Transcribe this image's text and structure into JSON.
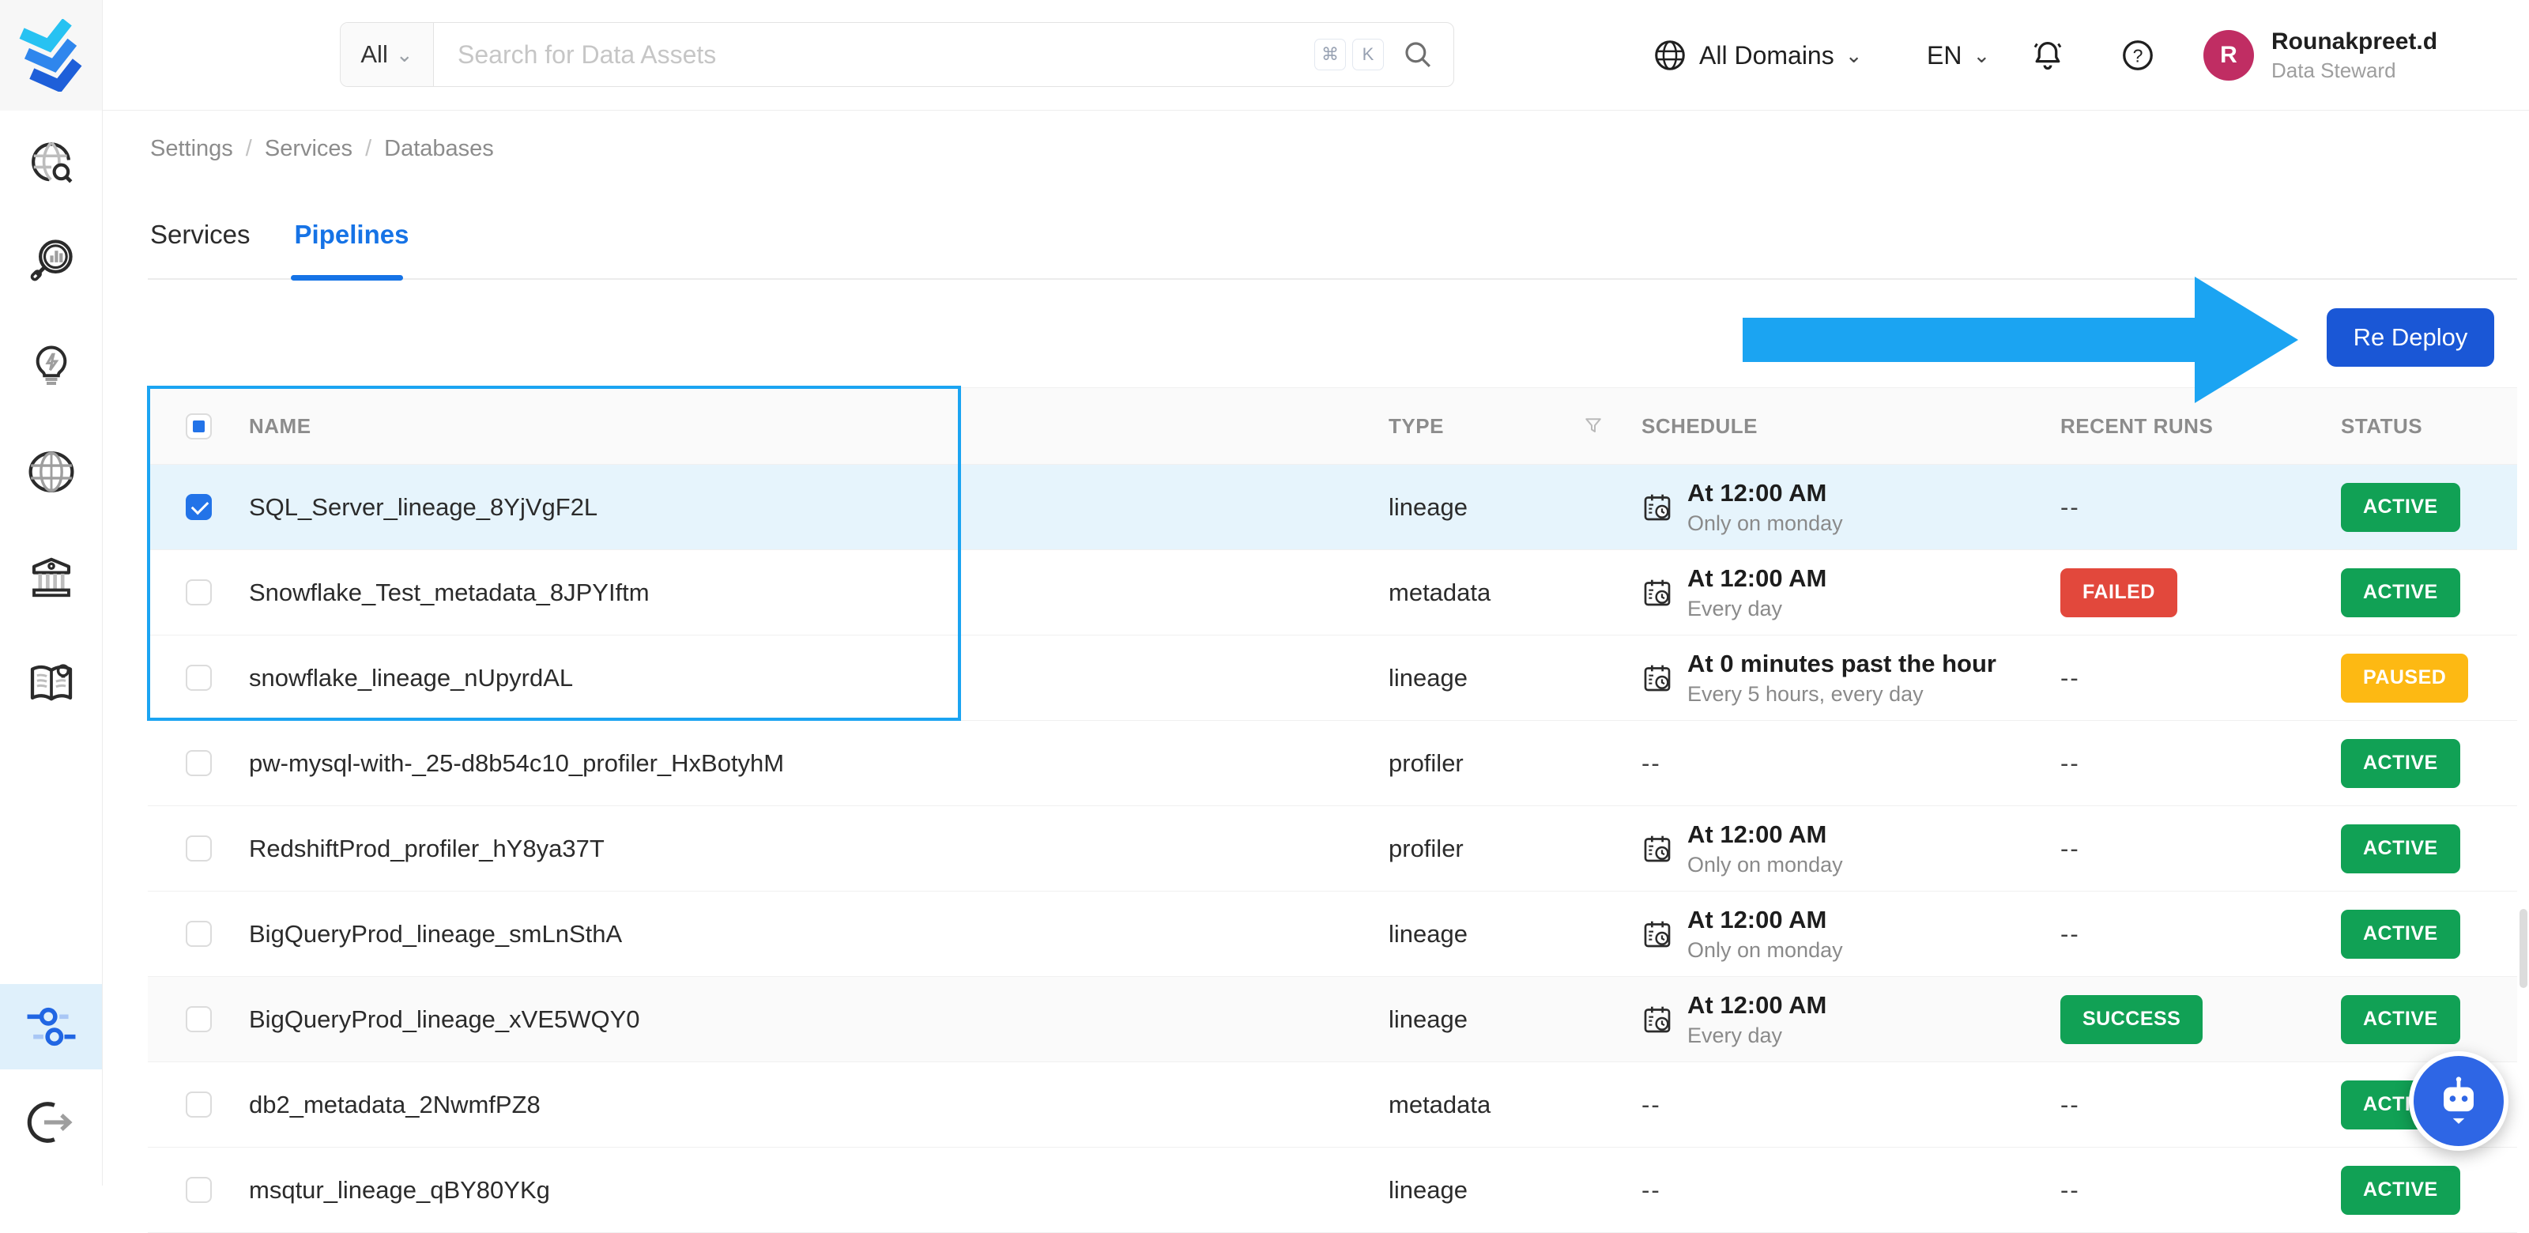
{
  "topbar": {
    "search": {
      "scope": "All",
      "placeholder": "Search for Data Assets",
      "kbd": [
        "⌘",
        "K"
      ]
    },
    "domains_label": "All Domains",
    "language": "EN",
    "user": {
      "initial": "R",
      "name": "Rounakpreet.d",
      "role": "Data Steward"
    }
  },
  "sidebar": {
    "items": [
      "explore-icon",
      "observability-icon",
      "insights-icon",
      "domains-icon",
      "govern-icon",
      "glossary-icon",
      "settings-icon",
      "logout-icon"
    ],
    "active_item": "settings-icon"
  },
  "breadcrumb": {
    "items": [
      "Settings",
      "Services",
      "Databases"
    ],
    "separator": "/"
  },
  "tabs": [
    {
      "label": "Services",
      "active": false
    },
    {
      "label": "Pipelines",
      "active": true
    }
  ],
  "redeploy_label": "Re Deploy",
  "table": {
    "headers": {
      "name": "NAME",
      "type": "TYPE",
      "schedule": "SCHEDULE",
      "recent_runs": "RECENT RUNS",
      "status": "STATUS"
    },
    "select_all_state": "indeterminate",
    "rows": [
      {
        "name": "SQL_Server_lineage_8YjVgF2L",
        "type": "lineage",
        "schedule": {
          "time": "At 12:00 AM",
          "frequency": "Only on monday"
        },
        "recent_runs": "--",
        "status": "ACTIVE",
        "checked": true,
        "selected": true
      },
      {
        "name": "Snowflake_Test_metadata_8JPYIftm",
        "type": "metadata",
        "schedule": {
          "time": "At 12:00 AM",
          "frequency": "Every day"
        },
        "recent_runs": "FAILED",
        "status": "ACTIVE",
        "checked": false
      },
      {
        "name": "snowflake_lineage_nUpyrdAL",
        "type": "lineage",
        "schedule": {
          "time": "At 0 minutes past the hour",
          "frequency": "Every 5 hours, every day"
        },
        "recent_runs": "--",
        "status": "PAUSED",
        "checked": false
      },
      {
        "name": "pw-mysql-with-_25-d8b54c10_profiler_HxBotyhM",
        "type": "profiler",
        "schedule": null,
        "recent_runs": "--",
        "status": "ACTIVE",
        "checked": false
      },
      {
        "name": "RedshiftProd_profiler_hY8ya37T",
        "type": "profiler",
        "schedule": {
          "time": "At 12:00 AM",
          "frequency": "Only on monday"
        },
        "recent_runs": "--",
        "status": "ACTIVE",
        "checked": false
      },
      {
        "name": "BigQueryProd_lineage_smLnSthA",
        "type": "lineage",
        "schedule": {
          "time": "At 12:00 AM",
          "frequency": "Only on monday"
        },
        "recent_runs": "--",
        "status": "ACTIVE",
        "checked": false
      },
      {
        "name": "BigQueryProd_lineage_xVE5WQY0",
        "type": "lineage",
        "schedule": {
          "time": "At 12:00 AM",
          "frequency": "Every day"
        },
        "recent_runs": "SUCCESS",
        "status": "ACTIVE",
        "checked": false,
        "hover": true
      },
      {
        "name": "db2_metadata_2NwmfPZ8",
        "type": "metadata",
        "schedule": null,
        "recent_runs": "--",
        "status": "ACTIVE",
        "checked": false
      },
      {
        "name": "msqtur_lineage_qBY80YKg",
        "type": "lineage",
        "schedule": null,
        "recent_runs": "--",
        "status": "ACTIVE",
        "checked": false,
        "partial": true
      }
    ]
  },
  "colors": {
    "primary_blue": "#1673E6",
    "redeploy_button": "#1A57D6",
    "annotation_blue": "#1BA4F2",
    "badge_green": "#11A155",
    "badge_red": "#E2483C",
    "badge_yellow": "#FDB913",
    "selected_row_bg": "#E6F4FC",
    "avatar_bg": "#C02D63",
    "checkbox_blue": "#2273E8"
  }
}
